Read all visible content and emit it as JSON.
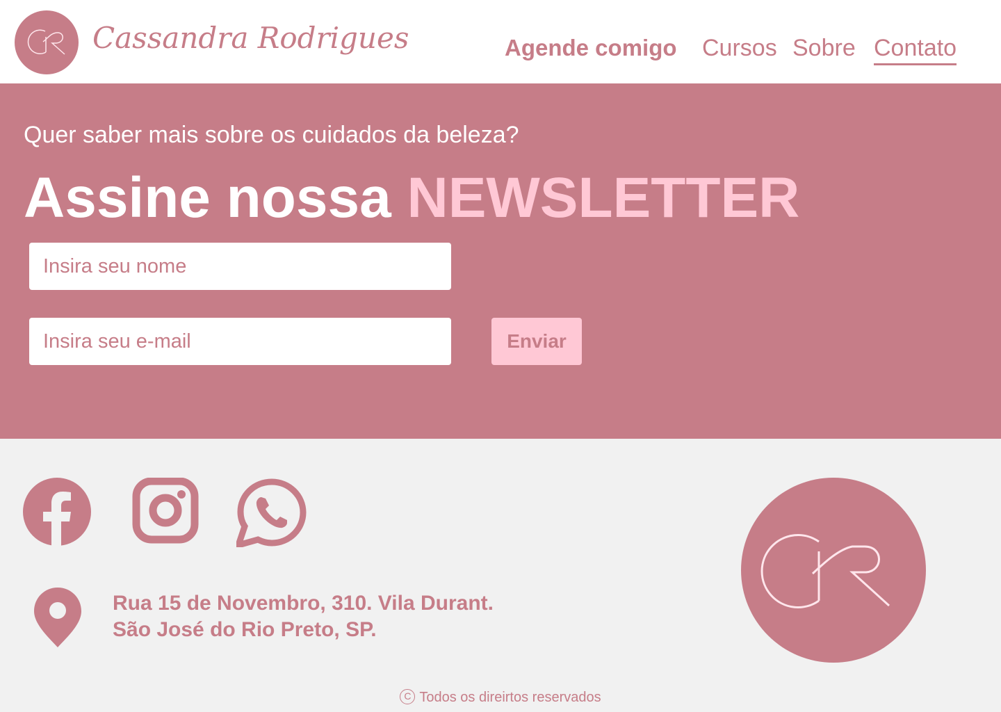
{
  "header": {
    "brand_name": "Cassandra Rodrigues",
    "logo_icon": "cr-monogram-icon",
    "nav": [
      {
        "label": "Agende comigo",
        "active": false,
        "bold": true
      },
      {
        "label": "Cursos",
        "active": false
      },
      {
        "label": "Sobre",
        "active": false
      },
      {
        "label": "Contato",
        "active": true
      }
    ]
  },
  "newsletter": {
    "subtitle": "Quer saber mais sobre os cuidados da beleza?",
    "headline_prefix": "Assine nossa",
    "headline_accent": "NEWSLETTER",
    "name_placeholder": "Insira seu nome",
    "email_placeholder": "Insira seu e-mail",
    "submit_label": "Enviar"
  },
  "footer": {
    "social": [
      {
        "name": "facebook-icon"
      },
      {
        "name": "instagram-icon"
      },
      {
        "name": "whatsapp-icon"
      }
    ],
    "address_line1": "Rua 15 de Novembro, 310. Vila Durant.",
    "address_line2": "São José do Rio Preto, SP.",
    "copyright_symbol": "C",
    "copyright": "Todos os direirtos reservados"
  },
  "colors": {
    "primary": "#c67d88",
    "accent": "#ffc8d5",
    "footer_bg": "#f1f1f1",
    "white": "#ffffff"
  }
}
